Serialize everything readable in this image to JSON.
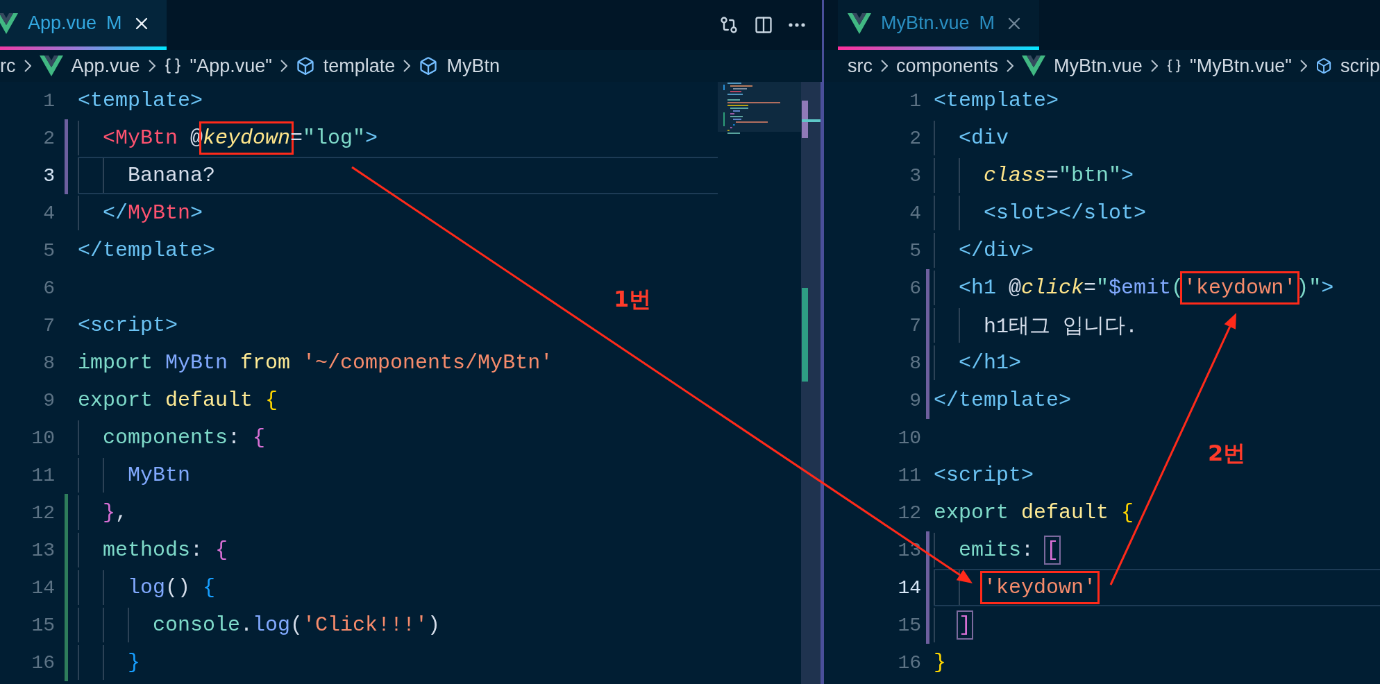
{
  "panes": [
    {
      "tab": {
        "label": "App.vue",
        "status": "M",
        "selected": true
      },
      "actions": [
        {
          "kind": "compare"
        },
        {
          "kind": "split"
        },
        {
          "kind": "more"
        }
      ],
      "breadcrumb": [
        {
          "label": "rc",
          "kind": "folder"
        },
        {
          "label": "App.vue",
          "kind": "vue-file"
        },
        {
          "label": "\"App.vue\"",
          "kind": "module"
        },
        {
          "label": "template",
          "kind": "element"
        },
        {
          "label": "MyBtn",
          "kind": "element"
        }
      ],
      "lines": [
        {
          "number": "1",
          "current": false,
          "tokens": [
            {
              "t": "<template>",
              "kind": "tag"
            }
          ],
          "children": [
            {
              "number": "2",
              "current": false,
              "marker": {
                "kind": "modified"
              },
              "tokens": [
                {
                  "t": "<MyBtn",
                  "kind": "component"
                },
                {
                  "t": " @",
                  "kind": "plain"
                },
                {
                  "t": "keydown",
                  "kind": "attr",
                  "boxed": true
                },
                {
                  "t": "=",
                  "kind": "plain"
                },
                {
                  "t": "\"log\"",
                  "kind": "string"
                },
                {
                  "t": ">",
                  "kind": "tag"
                }
              ],
              "children": [
                {
                  "number": "3",
                  "current": true,
                  "marker": {
                    "kind": "modified"
                  },
                  "tokens": [
                    {
                      "t": "Banana?",
                      "kind": "plain"
                    }
                  ]
                }
              ]
            },
            {
              "number": "4",
              "current": false,
              "tokens": [
                {
                  "t": "</",
                  "kind": "tag"
                },
                {
                  "t": "MyBtn",
                  "kind": "component"
                },
                {
                  "t": ">",
                  "kind": "tag"
                }
              ]
            }
          ]
        },
        {
          "number": "5",
          "current": false,
          "tokens": [
            {
              "t": "</template>",
              "kind": "tag"
            }
          ]
        },
        {
          "number": "6",
          "current": false
        },
        {
          "number": "7",
          "current": false,
          "tokens": [
            {
              "t": "<script>",
              "kind": "tag"
            }
          ]
        },
        {
          "number": "8",
          "current": false,
          "tokens": [
            {
              "t": "import ",
              "kind": "keyword"
            },
            {
              "t": "MyBtn ",
              "kind": "identifier"
            },
            {
              "t": "from ",
              "kind": "keyword2"
            },
            {
              "t": "'~/components/MyBtn'",
              "kind": "literal"
            }
          ]
        },
        {
          "number": "9",
          "current": false,
          "tokens": [
            {
              "t": "export ",
              "kind": "keyword"
            },
            {
              "t": "default ",
              "kind": "keyword2"
            },
            {
              "t": "{",
              "kind": "brace1"
            }
          ],
          "children": [
            {
              "number": "10",
              "current": false,
              "tokens": [
                {
                  "t": "components",
                  "kind": "property"
                },
                {
                  "t": ": ",
                  "kind": "plain"
                },
                {
                  "t": "{",
                  "kind": "brace2"
                }
              ],
              "children": [
                {
                  "number": "11",
                  "current": false,
                  "tokens": [
                    {
                      "t": "MyBtn",
                      "kind": "identifier"
                    }
                  ]
                }
              ]
            },
            {
              "number": "12",
              "current": false,
              "marker": {
                "kind": "added"
              },
              "tokens": [
                {
                  "t": "}",
                  "kind": "brace2"
                },
                {
                  "t": ",",
                  "kind": "plain"
                }
              ]
            },
            {
              "number": "13",
              "current": false,
              "marker": {
                "kind": "added"
              },
              "tokens": [
                {
                  "t": "methods",
                  "kind": "property"
                },
                {
                  "t": ": ",
                  "kind": "plain"
                },
                {
                  "t": "{",
                  "kind": "brace2"
                }
              ],
              "children": [
                {
                  "number": "14",
                  "current": false,
                  "marker": {
                    "kind": "added"
                  },
                  "tokens": [
                    {
                      "t": "log",
                      "kind": "function"
                    },
                    {
                      "t": "() ",
                      "kind": "plain"
                    },
                    {
                      "t": "{",
                      "kind": "brace3"
                    }
                  ],
                  "children": [
                    {
                      "number": "15",
                      "current": false,
                      "marker": {
                        "kind": "added"
                      },
                      "tokens": [
                        {
                          "t": "console",
                          "kind": "property"
                        },
                        {
                          "t": ".",
                          "kind": "plain"
                        },
                        {
                          "t": "log",
                          "kind": "function"
                        },
                        {
                          "t": "(",
                          "kind": "plain"
                        },
                        {
                          "t": "'Click!!!'",
                          "kind": "literal"
                        },
                        {
                          "t": ")",
                          "kind": "plain"
                        }
                      ]
                    }
                  ]
                },
                {
                  "number": "16",
                  "current": false,
                  "marker": {
                    "kind": "added"
                  },
                  "tokens": [
                    {
                      "t": "}",
                      "kind": "brace3"
                    }
                  ]
                }
              ]
            }
          ]
        }
      ]
    },
    {
      "tab": {
        "label": "MyBtn.vue",
        "status": "M",
        "selected": false
      },
      "breadcrumb": [
        {
          "label": "src",
          "kind": "folder"
        },
        {
          "label": "components",
          "kind": "folder"
        },
        {
          "label": "MyBtn.vue",
          "kind": "vue-file"
        },
        {
          "label": "\"MyBtn.vue\"",
          "kind": "module"
        },
        {
          "label": "scrip",
          "kind": "element"
        }
      ],
      "lines": [
        {
          "number": "1",
          "current": false,
          "tokens": [
            {
              "t": "<template>",
              "kind": "tag"
            }
          ],
          "children": [
            {
              "number": "2",
              "current": false,
              "tokens": [
                {
                  "t": "<div",
                  "kind": "tag"
                }
              ],
              "children": [
                {
                  "number": "3",
                  "current": false,
                  "tokens": [
                    {
                      "t": "class",
                      "kind": "attr"
                    },
                    {
                      "t": "=",
                      "kind": "plain"
                    },
                    {
                      "t": "\"btn\"",
                      "kind": "string"
                    },
                    {
                      "t": ">",
                      "kind": "tag"
                    }
                  ]
                },
                {
                  "number": "4",
                  "current": false,
                  "tokens": [
                    {
                      "t": "<slot></slot>",
                      "kind": "tag"
                    }
                  ]
                }
              ]
            },
            {
              "number": "5",
              "current": false,
              "tokens": [
                {
                  "t": "</div>",
                  "kind": "tag"
                }
              ]
            },
            {
              "number": "6",
              "current": false,
              "marker": {
                "kind": "modified"
              },
              "tokens": [
                {
                  "t": "<h1 ",
                  "kind": "tag"
                },
                {
                  "t": "@",
                  "kind": "plain"
                },
                {
                  "t": "click",
                  "kind": "attr"
                },
                {
                  "t": "=",
                  "kind": "plain"
                },
                {
                  "t": "\"",
                  "kind": "string"
                },
                {
                  "t": "$emit",
                  "kind": "function"
                },
                {
                  "t": "(",
                  "kind": "string"
                },
                {
                  "t": "'keydown'",
                  "kind": "literal",
                  "boxed": true
                },
                {
                  "t": ")\"",
                  "kind": "string"
                },
                {
                  "t": ">",
                  "kind": "tag"
                }
              ],
              "children": [
                {
                  "number": "7",
                  "current": false,
                  "marker": {
                    "kind": "modified"
                  },
                  "tokens": [
                    {
                      "t": "h1태그 입니다.",
                      "kind": "plain"
                    }
                  ]
                }
              ]
            },
            {
              "number": "8",
              "current": false,
              "marker": {
                "kind": "modified"
              },
              "tokens": [
                {
                  "t": "</h1>",
                  "kind": "tag"
                }
              ]
            }
          ]
        },
        {
          "number": "9",
          "current": false,
          "marker": {
            "kind": "modified"
          },
          "tokens": [
            {
              "t": "</template>",
              "kind": "tag"
            }
          ]
        },
        {
          "number": "10",
          "current": false
        },
        {
          "number": "11",
          "current": false,
          "tokens": [
            {
              "t": "<script>",
              "kind": "tag"
            }
          ]
        },
        {
          "number": "12",
          "current": false,
          "tokens": [
            {
              "t": "export ",
              "kind": "keyword"
            },
            {
              "t": "default ",
              "kind": "keyword2"
            },
            {
              "t": "{",
              "kind": "brace1"
            }
          ],
          "children": [
            {
              "number": "13",
              "current": false,
              "marker": {
                "kind": "modified"
              },
              "tokens": [
                {
                  "t": "emits",
                  "kind": "property"
                },
                {
                  "t": ": ",
                  "kind": "plain"
                },
                {
                  "t": "[",
                  "kind": "brace2",
                  "bracket_match": true
                }
              ],
              "children": [
                {
                  "number": "14",
                  "current": true,
                  "marker": {
                    "kind": "modified"
                  },
                  "tokens": [
                    {
                      "t": "'keydown'",
                      "kind": "literal",
                      "boxed": true
                    }
                  ]
                }
              ]
            },
            {
              "number": "15",
              "current": false,
              "marker": {
                "kind": "modified"
              },
              "tokens": [
                {
                  "t": "]",
                  "kind": "brace2",
                  "bracket_match": true
                }
              ]
            }
          ]
        },
        {
          "number": "16",
          "current": false,
          "tokens": [
            {
              "t": "}",
              "kind": "brace1"
            }
          ]
        }
      ]
    }
  ],
  "annotations": [
    {
      "label": "1번"
    },
    {
      "label": "2번"
    }
  ]
}
